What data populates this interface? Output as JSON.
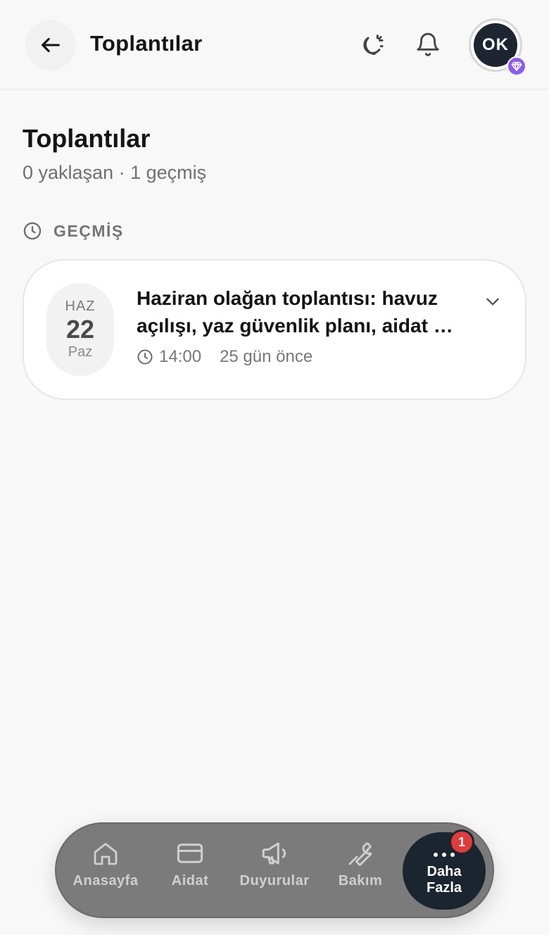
{
  "header": {
    "title": "Toplantılar",
    "avatar_initials": "OK"
  },
  "content": {
    "title": "Toplantılar",
    "subtitle": "0 yaklaşan · 1 geçmiş",
    "section_label": "GEÇMİŞ"
  },
  "meetings": [
    {
      "month": "HAZ",
      "day": "22",
      "weekday": "Paz",
      "title": "Haziran olağan toplantısı: havuz açılışı, yaz güvenlik planı, aidat …",
      "time": "14:00",
      "relative": "25 gün önce"
    }
  ],
  "nav": {
    "home": "Anasayfa",
    "dues": "Aidat",
    "announcements": "Duyurular",
    "maintenance": "Bakım",
    "more": "Daha Fazla",
    "more_badge": "1"
  },
  "colors": {
    "premium_badge": "#8b5cf6",
    "nav_background": "#7b7b7b",
    "nav_active": "#1b2530",
    "notification_badge": "#e23b3b"
  },
  "icons": [
    "arrow-left-icon",
    "moon-sun-icon",
    "bell-icon",
    "diamond-icon",
    "clock-icon",
    "chevron-down-icon",
    "home-icon",
    "card-icon",
    "megaphone-icon",
    "wrench-icon",
    "more-dots-icon"
  ]
}
